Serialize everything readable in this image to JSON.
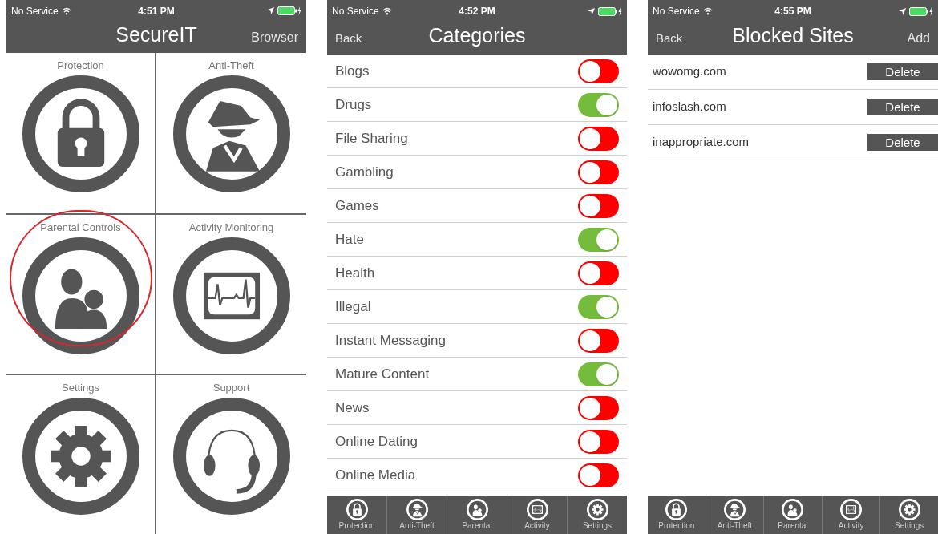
{
  "screens": [
    {
      "kind": "home",
      "status_bar": {
        "carrier": "No Service",
        "time": "4:51 PM"
      },
      "nav": {
        "title": "SecureIT",
        "right": "Browser"
      },
      "tiles": [
        {
          "label": "Protection",
          "kind": "lock",
          "highlighted": false
        },
        {
          "label": "Anti-Theft",
          "kind": "spy",
          "highlighted": false
        },
        {
          "label": "Parental Controls",
          "kind": "family",
          "highlighted": true
        },
        {
          "label": "Activity Monitoring",
          "kind": "monitor",
          "highlighted": false
        },
        {
          "label": "Settings",
          "kind": "gear",
          "highlighted": false
        },
        {
          "label": "Support",
          "kind": "headset",
          "highlighted": false
        }
      ]
    },
    {
      "kind": "categories",
      "status_bar": {
        "carrier": "No Service",
        "time": "4:52 PM"
      },
      "nav": {
        "left": "Back",
        "title": "Categories"
      },
      "categories": [
        {
          "label": "Blogs",
          "on": false
        },
        {
          "label": "Drugs",
          "on": true
        },
        {
          "label": "File Sharing",
          "on": false
        },
        {
          "label": "Gambling",
          "on": false
        },
        {
          "label": "Games",
          "on": false
        },
        {
          "label": "Hate",
          "on": true
        },
        {
          "label": "Health",
          "on": false
        },
        {
          "label": "Illegal",
          "on": true
        },
        {
          "label": "Instant Messaging",
          "on": false
        },
        {
          "label": "Mature Content",
          "on": true
        },
        {
          "label": "News",
          "on": false
        },
        {
          "label": "Online Dating",
          "on": false
        },
        {
          "label": "Online Media",
          "on": false
        }
      ],
      "tabs": [
        {
          "label": "Protection",
          "kind": "lock"
        },
        {
          "label": "Anti-Theft",
          "kind": "spy"
        },
        {
          "label": "Parental",
          "kind": "family"
        },
        {
          "label": "Activity",
          "kind": "monitor"
        },
        {
          "label": "Settings",
          "kind": "gear"
        }
      ]
    },
    {
      "kind": "sites",
      "status_bar": {
        "carrier": "No Service",
        "time": "4:55 PM"
      },
      "nav": {
        "left": "Back",
        "title": "Blocked Sites",
        "right": "Add"
      },
      "sites": [
        {
          "domain": "wowomg.com",
          "action": "Delete"
        },
        {
          "domain": "infoslash.com",
          "action": "Delete"
        },
        {
          "domain": "inappropriate.com",
          "action": "Delete"
        }
      ],
      "tabs": [
        {
          "label": "Protection",
          "kind": "lock"
        },
        {
          "label": "Anti-Theft",
          "kind": "spy"
        },
        {
          "label": "Parental",
          "kind": "family"
        },
        {
          "label": "Activity",
          "kind": "monitor"
        },
        {
          "label": "Settings",
          "kind": "gear"
        }
      ]
    }
  ]
}
